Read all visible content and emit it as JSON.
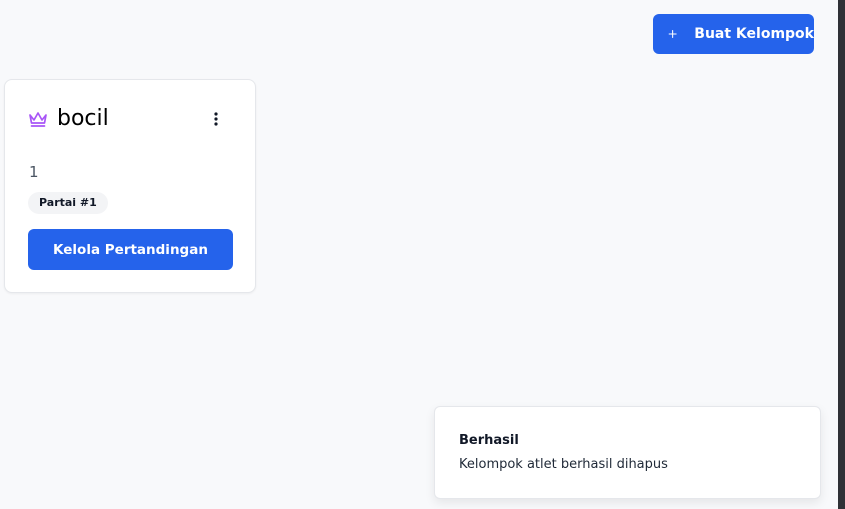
{
  "header": {
    "create_button_label": "Buat Kelompok"
  },
  "groups": [
    {
      "name": "bocil",
      "count": "1",
      "badge": "Partai #1",
      "manage_button_label": "Kelola Pertandingan"
    }
  ],
  "toast": {
    "title": "Berhasil",
    "message": "Kelompok atlet berhasil dihapus"
  },
  "colors": {
    "primary": "#2563eb",
    "crown": "#a855f7",
    "background": "#f8f9fb"
  },
  "icons": {
    "create": "plus-icon",
    "group": "crown-icon",
    "menu": "more-vertical-icon"
  }
}
